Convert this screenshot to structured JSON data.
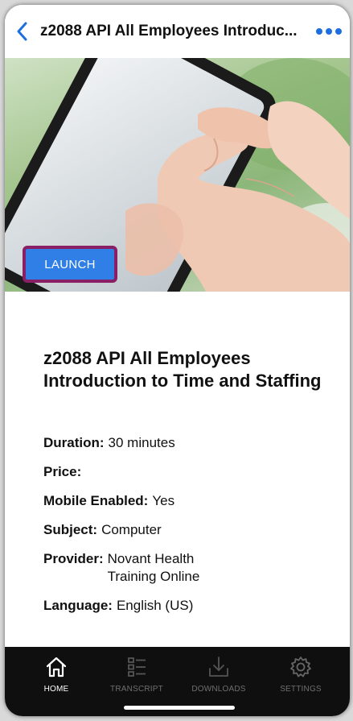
{
  "header": {
    "title": "z2088 API All Employees Introduc...",
    "back_icon": "chevron-left-icon",
    "more_icon": "ellipsis-icon",
    "accent_color": "#1d6fe0"
  },
  "hero": {
    "launch_label": "LAUNCH",
    "launch_color": "#2f7fe6",
    "launch_border_color": "#8a1f66"
  },
  "course": {
    "title": "z2088 API All Employees Introduction to Time and Staffing"
  },
  "details": [
    {
      "key": "Duration:",
      "value": "30 minutes"
    },
    {
      "key": "Price:",
      "value": ""
    },
    {
      "key": "Mobile Enabled:",
      "value": "Yes"
    },
    {
      "key": "Subject:",
      "value": "Computer"
    },
    {
      "key": "Provider:",
      "value": "Novant Health Training Online"
    },
    {
      "key": "Language:",
      "value": "English (US)"
    }
  ],
  "tabbar": {
    "tabs": [
      {
        "label": "HOME",
        "icon": "home-icon",
        "active": true
      },
      {
        "label": "TRANSCRIPT",
        "icon": "list-icon",
        "active": false
      },
      {
        "label": "DOWNLOADS",
        "icon": "download-icon",
        "active": false
      },
      {
        "label": "SETTINGS",
        "icon": "gear-icon",
        "active": false
      }
    ]
  }
}
